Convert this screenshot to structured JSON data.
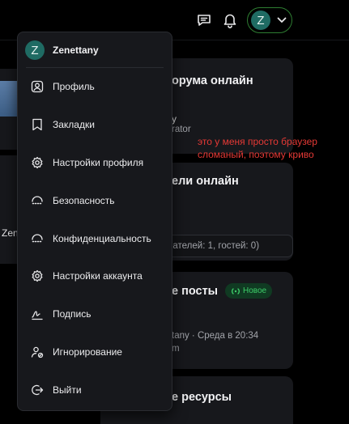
{
  "header": {
    "user_initial": "Z",
    "icons": {
      "messages": "chat-icon",
      "alerts": "bell-icon",
      "menu_toggle": "chevron-down-icon"
    },
    "accent_color": "#2e7d32"
  },
  "menu": {
    "username": "Zenettany",
    "initial": "Z",
    "items": [
      {
        "label": "Профиль",
        "icon": "user-icon"
      },
      {
        "label": "Закладки",
        "icon": "bookmark-icon"
      },
      {
        "label": "Настройки профиля",
        "icon": "gear-icon"
      },
      {
        "label": "Безопасность",
        "icon": "shield-icon"
      },
      {
        "label": "Конфиденциальность",
        "icon": "privacy-icon"
      },
      {
        "label": "Настройки аккаунта",
        "icon": "gear-icon"
      },
      {
        "label": "Подпись",
        "icon": "signature-icon"
      },
      {
        "label": "Игнорирование",
        "icon": "ignore-user-icon"
      },
      {
        "label": "Выйти",
        "icon": "logout-icon"
      }
    ]
  },
  "background": {
    "left_fragment": "Zen",
    "staff_card": {
      "title_fragment": "орума онлайн",
      "name_fragment": "y",
      "role_fragment": "rator"
    },
    "members_card": {
      "title_fragment": "ели онлайн",
      "stats_fragment": "ователей: 1, гостей: 0)"
    },
    "posts_card": {
      "title_fragment": "е посты",
      "badge": "Новое",
      "meta_fragment": "tany · Среда в 20:34",
      "sub_fragment": "m"
    },
    "resources_card": {
      "title_fragment": "е ресурсы"
    }
  },
  "annotation": {
    "line1": "это у меня просто браузер",
    "line2": "сломаный, поэтому криво",
    "color": "#e53935"
  }
}
